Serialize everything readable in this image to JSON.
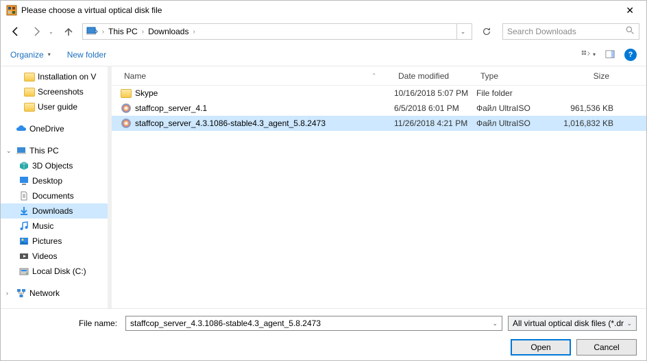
{
  "title": "Please choose a virtual optical disk file",
  "breadcrumb": {
    "root": "This PC",
    "folder": "Downloads"
  },
  "search": {
    "placeholder": "Search Downloads"
  },
  "toolbar": {
    "organize": "Organize",
    "newfolder": "New folder"
  },
  "sidebar": {
    "quick": [
      {
        "label": "Installation on V"
      },
      {
        "label": "Screenshots"
      },
      {
        "label": "User guide"
      }
    ],
    "onedrive": "OneDrive",
    "thispc": "This PC",
    "pcitems": [
      {
        "label": "3D Objects",
        "icon": "3d"
      },
      {
        "label": "Desktop",
        "icon": "desktop"
      },
      {
        "label": "Documents",
        "icon": "documents"
      },
      {
        "label": "Downloads",
        "icon": "downloads",
        "selected": true
      },
      {
        "label": "Music",
        "icon": "music"
      },
      {
        "label": "Pictures",
        "icon": "pictures"
      },
      {
        "label": "Videos",
        "icon": "videos"
      },
      {
        "label": "Local Disk (C:)",
        "icon": "disk"
      }
    ],
    "network": "Network"
  },
  "columns": {
    "name": "Name",
    "date": "Date modified",
    "type": "Type",
    "size": "Size"
  },
  "files": [
    {
      "icon": "folder",
      "name": "Skype",
      "date": "10/16/2018 5:07 PM",
      "type": "File folder",
      "size": ""
    },
    {
      "icon": "disc",
      "name": "staffcop_server_4.1",
      "date": "6/5/2018 6:01 PM",
      "type": "Файл UltraISO",
      "size": "961,536 KB"
    },
    {
      "icon": "disc",
      "name": "staffcop_server_4.3.1086-stable4.3_agent_5.8.2473",
      "date": "11/26/2018 4:21 PM",
      "type": "Файл UltraISO",
      "size": "1,016,832 KB",
      "selected": true
    }
  ],
  "bottom": {
    "filelabel": "File name:",
    "filename": "staffcop_server_4.3.1086-stable4.3_agent_5.8.2473",
    "filter": "All virtual optical disk files (*.dr",
    "open": "Open",
    "cancel": "Cancel"
  }
}
